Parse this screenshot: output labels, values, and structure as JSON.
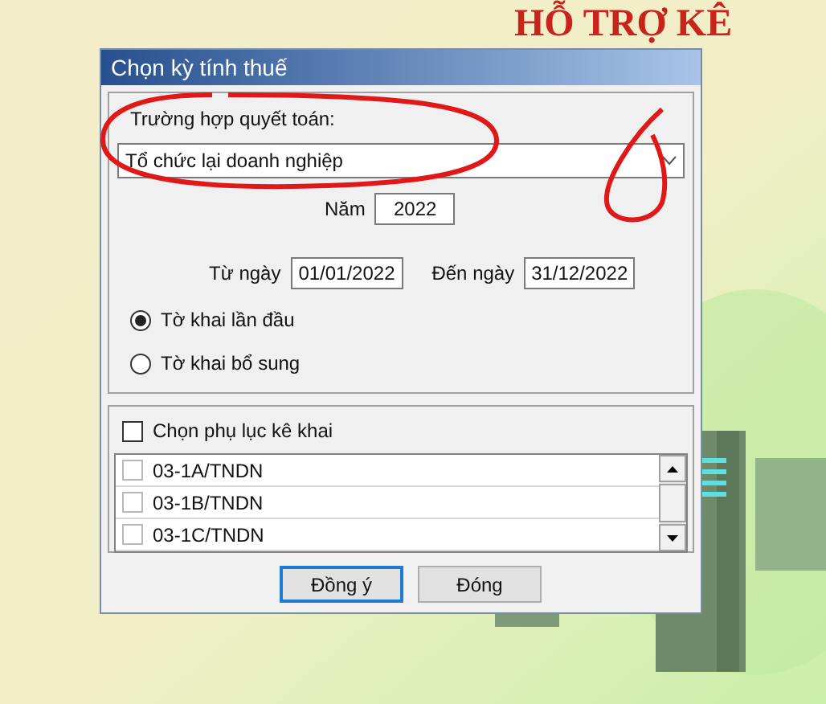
{
  "background": {
    "banner": "HỖ TRỢ KÊ"
  },
  "dialog": {
    "title": "Chọn kỳ tính thuế",
    "settlement_case": {
      "label": "Trường hợp quyết toán:",
      "value": "Tổ chức lại doanh nghiệp"
    },
    "year": {
      "label": "Năm",
      "value": "2022"
    },
    "from_date": {
      "label": "Từ ngày",
      "value": "01/01/2022"
    },
    "to_date": {
      "label": "Đến ngày",
      "value": "31/12/2022"
    },
    "declaration_types": [
      {
        "label": "Tờ khai lần đầu",
        "selected": true
      },
      {
        "label": "Tờ khai bổ sung",
        "selected": false
      }
    ],
    "appendix": {
      "label": "Chọn phụ lục kê khai",
      "checked": false,
      "items": [
        {
          "label": "03-1A/TNDN",
          "checked": false
        },
        {
          "label": "03-1B/TNDN",
          "checked": false
        },
        {
          "label": "03-1C/TNDN",
          "checked": false
        }
      ]
    },
    "buttons": [
      {
        "label": "Đồng ý",
        "focused": true
      },
      {
        "label": "Đóng",
        "focused": false
      }
    ]
  }
}
